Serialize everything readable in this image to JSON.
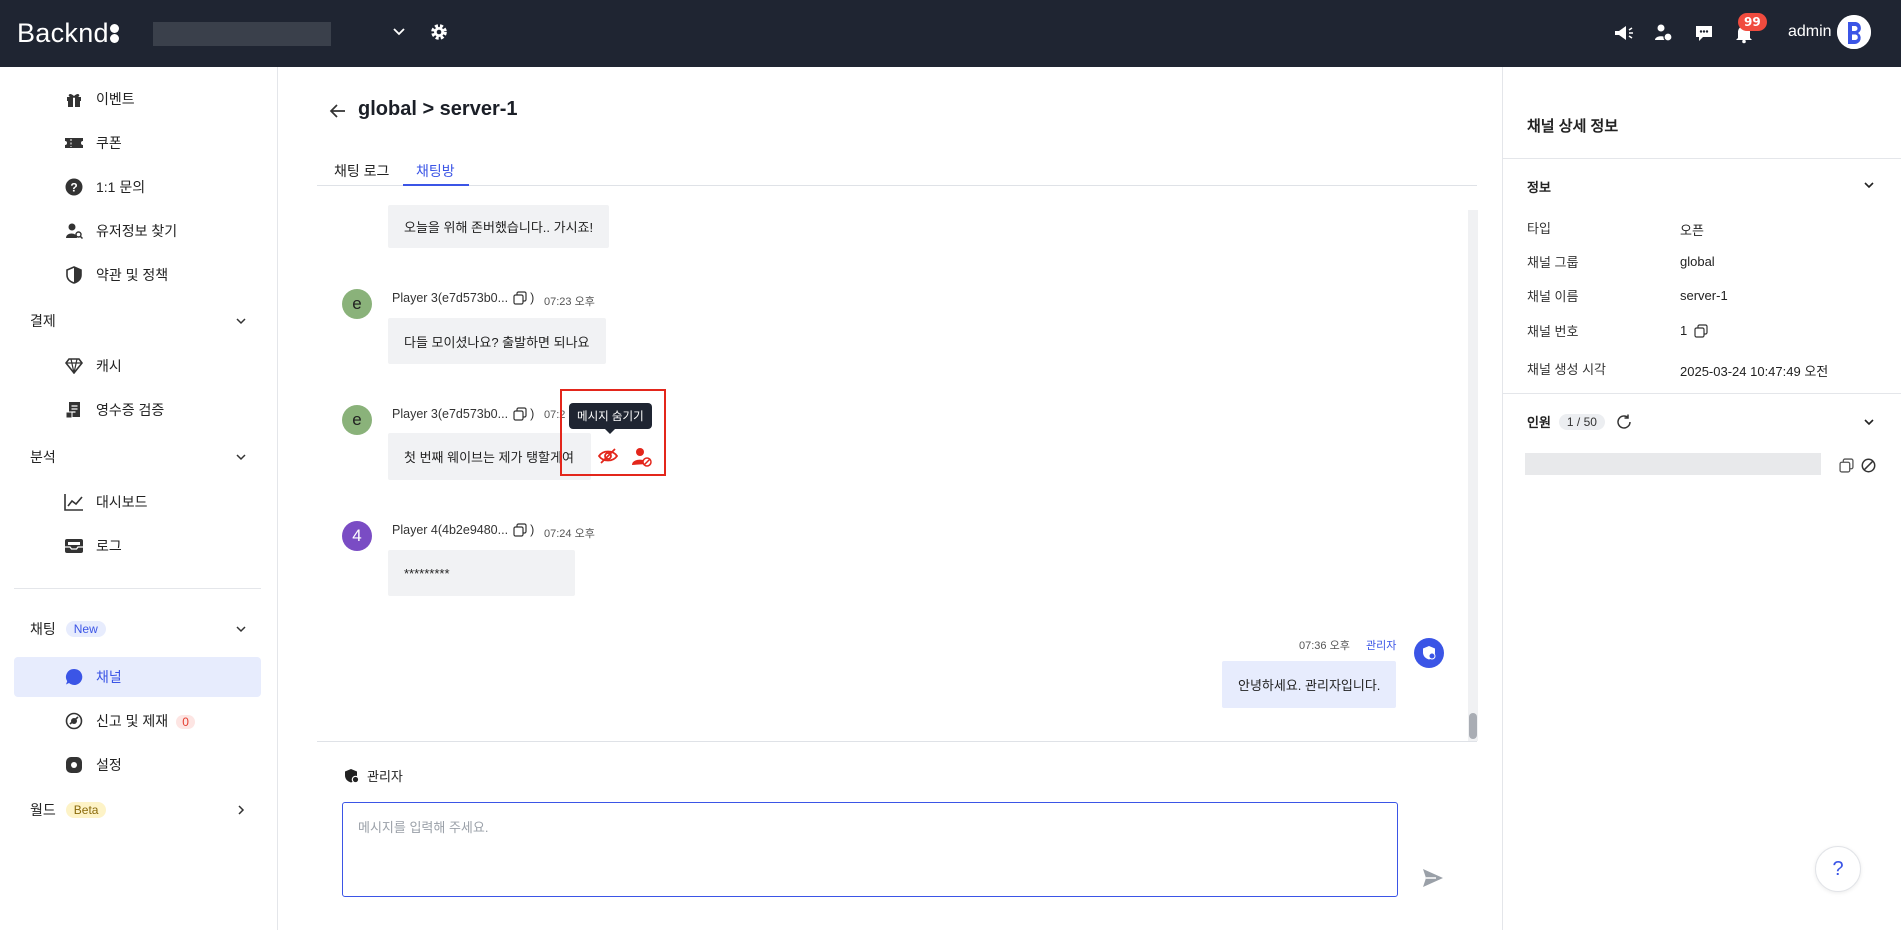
{
  "topbar": {
    "logo": "Backnd",
    "notifications_count": "99",
    "admin_name": "admin",
    "icons": [
      "megaphone-icon",
      "user-swap-icon",
      "chat-bubble-icon",
      "bell-icon"
    ]
  },
  "sidebar": {
    "items": [
      {
        "label": "이벤트",
        "icon": "gift-icon"
      },
      {
        "label": "쿠폰",
        "icon": "ticket-icon"
      },
      {
        "label": "1:1 문의",
        "icon": "question-icon"
      },
      {
        "label": "유저정보 찾기",
        "icon": "user-search-icon"
      },
      {
        "label": "약관 및 정책",
        "icon": "shield-icon"
      }
    ],
    "group_payment": "결제",
    "payment_items": [
      {
        "label": "캐시",
        "icon": "diamond-icon"
      },
      {
        "label": "영수증 검증",
        "icon": "receipt-icon"
      }
    ],
    "group_analytics": "분석",
    "analytics_items": [
      {
        "label": "대시보드",
        "icon": "chart-line-icon"
      },
      {
        "label": "로그",
        "icon": "inbox-icon"
      }
    ],
    "group_chat": "채팅",
    "chat_tag": "New",
    "chat_items": [
      {
        "label": "채널",
        "icon": "chat-bubble-icon",
        "active": true
      },
      {
        "label": "신고 및 제재",
        "icon": "report-icon",
        "badge": "0"
      },
      {
        "label": "설정",
        "icon": "gear-icon"
      }
    ],
    "group_world": "월드",
    "world_tag": "Beta"
  },
  "main": {
    "title": "global > server-1",
    "tabs": [
      {
        "label": "채팅 로그",
        "active": false
      },
      {
        "label": "채팅방",
        "active": true
      }
    ],
    "messages": [
      {
        "text": "오늘을 위해 존버했습니다.. 가시죠!"
      },
      {
        "avatar": "e",
        "name": "Player 3(e7d573b0...",
        "paren": ")",
        "time": "07:23 오후",
        "text": "다들 모이셨나요? 출발하면 되나요"
      },
      {
        "avatar": "e",
        "name": "Player 3(e7d573b0...",
        "paren": ")",
        "time": "07:2",
        "text": "첫 번째 웨이브는 제가 탱할게여"
      },
      {
        "avatar": "4",
        "name": "Player 4(4b2e9480...",
        "paren": ")",
        "time": "07:24 오후",
        "text": "*********"
      },
      {
        "time": "07:36 오후",
        "sender": "관리자",
        "text": "안녕하세요. 관리자입니다."
      }
    ],
    "tooltip": "메시지 숨기기",
    "composer_label": "관리자",
    "composer_placeholder": "메시지를 입력해 주세요.",
    "help": "?"
  },
  "rpanel": {
    "title": "채널 상세 정보",
    "section_info": "정보",
    "fields": [
      {
        "key": "타입",
        "value": "오픈"
      },
      {
        "key": "채널 그룹",
        "value": "global"
      },
      {
        "key": "채널 이름",
        "value": "server-1"
      },
      {
        "key": "채널 번호",
        "value": "1"
      },
      {
        "key": "채널 생성 시각",
        "value": "2025-03-24 10:47:49 오전"
      }
    ],
    "section_members": "인원",
    "members_count": "1 / 50"
  },
  "colors": {
    "topbar_bg": "#1f2532",
    "accent": "#3b55e6",
    "danger": "#e3261b",
    "avatar_e": "#8ab27a",
    "avatar_4": "#7a4cc4"
  }
}
